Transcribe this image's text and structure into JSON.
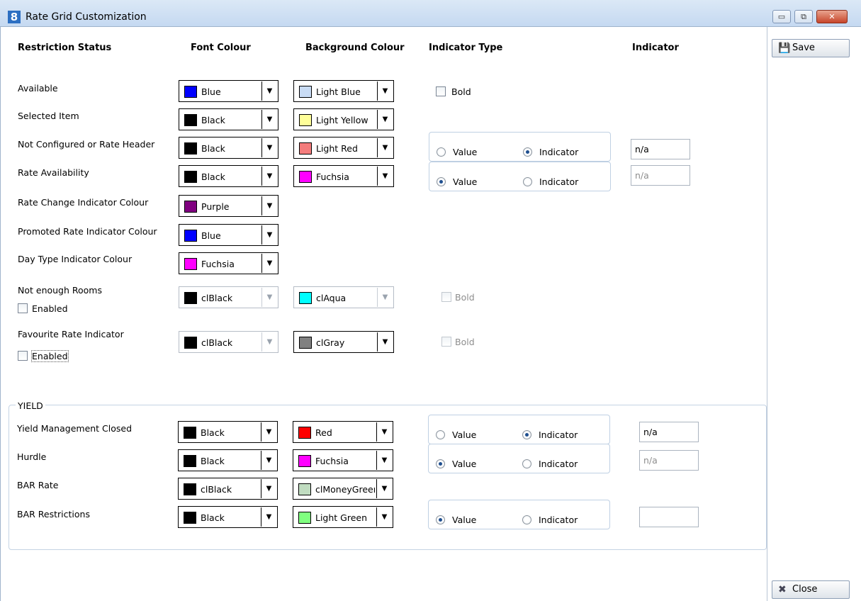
{
  "window": {
    "title": "Rate Grid Customization",
    "app_icon_glyph": "8",
    "buttons": {
      "minimize": "▭",
      "maximize": "⧉",
      "close": "✕"
    }
  },
  "side": {
    "save_label": "Save",
    "close_label": "Close"
  },
  "headers": {
    "status": "Restriction Status",
    "font": "Font Colour",
    "background": "Background Colour",
    "indicator_type": "Indicator Type",
    "indicator": "Indicator"
  },
  "labels": {
    "bold": "Bold",
    "enabled": "Enabled",
    "value": "Value",
    "indicator": "Indicator",
    "yield": "YIELD"
  },
  "rows": [
    {
      "label": "Available",
      "font": "Blue",
      "font_color": "#0000ff",
      "bg": "Light Blue",
      "bg_color": "#c9dcf5"
    },
    {
      "label": "Selected Item",
      "font": "Black",
      "font_color": "#000000",
      "bg": "Light Yellow",
      "bg_color": "#ffff99"
    },
    {
      "label": "Not Configured or Rate Header",
      "font": "Black",
      "font_color": "#000000",
      "bg": "Light Red",
      "bg_color": "#f47c7c",
      "indicator_value": "n/a"
    },
    {
      "label": "Rate Availability",
      "font": "Black",
      "font_color": "#000000",
      "bg": "Fuchsia",
      "bg_color": "#ff00ff",
      "indicator_value": "n/a"
    },
    {
      "label": "Rate Change Indicator Colour",
      "font": "Purple",
      "font_color": "#800080"
    },
    {
      "label": "Promoted Rate Indicator Colour",
      "font": "Blue",
      "font_color": "#0000ff"
    },
    {
      "label": "Day Type Indicator Colour",
      "font": "Fuchsia",
      "font_color": "#ff00ff"
    },
    {
      "label": "Not enough Rooms",
      "font": "clBlack",
      "font_color": "#000000",
      "bg": "clAqua",
      "bg_color": "#00ffff"
    },
    {
      "label": "Favourite Rate Indicator",
      "font": "clBlack",
      "font_color": "#000000",
      "bg": "clGray",
      "bg_color": "#808080"
    }
  ],
  "yield_rows": [
    {
      "label": "Yield Management  Closed",
      "font": "Black",
      "font_color": "#000000",
      "bg": "Red",
      "bg_color": "#ff0000",
      "indicator_value": "n/a"
    },
    {
      "label": "Hurdle",
      "font": "Black",
      "font_color": "#000000",
      "bg": "Fuchsia",
      "bg_color": "#ff00ff",
      "indicator_value": "n/a"
    },
    {
      "label": "BAR Rate",
      "font": "clBlack",
      "font_color": "#000000",
      "bg": "clMoneyGreen",
      "bg_color": "#c0dcc0"
    },
    {
      "label": "BAR Restrictions",
      "font": "Black",
      "font_color": "#000000",
      "bg": "Light Green",
      "bg_color": "#80ff80",
      "indicator_value": ""
    }
  ]
}
